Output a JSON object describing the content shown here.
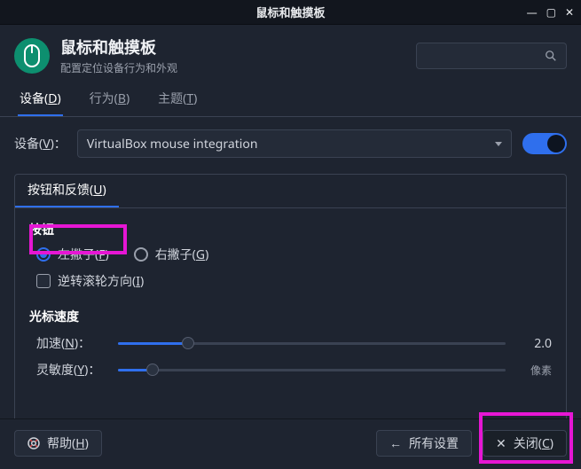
{
  "window": {
    "title": "鼠标和触摸板"
  },
  "header": {
    "title": "鼠标和触摸板",
    "subtitle": "配置定位设备行为和外观"
  },
  "tabs": {
    "items": [
      {
        "label": "设备(",
        "mnemonic": "D",
        "suffix": ")"
      },
      {
        "label": "行为(",
        "mnemonic": "B",
        "suffix": ")"
      },
      {
        "label": "主题(",
        "mnemonic": "T",
        "suffix": ")"
      }
    ],
    "active_index": 0
  },
  "device": {
    "label": "设备(",
    "label_mnemonic": "V",
    "label_suffix": ")：",
    "selected": "VirtualBox mouse integration",
    "enabled": true
  },
  "section": {
    "tab_label": "按钮和反馈(",
    "tab_mnemonic": "U",
    "tab_suffix": ")",
    "buttons_heading": "按钮",
    "radio_left": {
      "label": "左撇子(",
      "mnemonic": "F",
      "suffix": ")"
    },
    "radio_right": {
      "label": "右撇子(",
      "mnemonic": "G",
      "suffix": ")"
    },
    "reverse_scroll": {
      "label": "逆转滚轮方向(",
      "mnemonic": "I",
      "suffix": ")"
    },
    "pointer_heading": "光标速度",
    "accel": {
      "label": "加速(",
      "mnemonic": "N",
      "suffix": ")：",
      "value": "2.0",
      "fill_pct": 18
    },
    "sens": {
      "label": "灵敏度(",
      "mnemonic": "Y",
      "suffix": ")：",
      "value_partial": "像素",
      "fill_pct": 9
    }
  },
  "footer": {
    "help": {
      "label": "帮助(",
      "mnemonic": "H",
      "suffix": ")"
    },
    "all_settings": "所有设置",
    "close": {
      "label_partial": "关闭(",
      "mnemonic": "C",
      "suffix": ")"
    }
  },
  "highlights": {
    "radio_left_box": true,
    "close_box": true
  }
}
